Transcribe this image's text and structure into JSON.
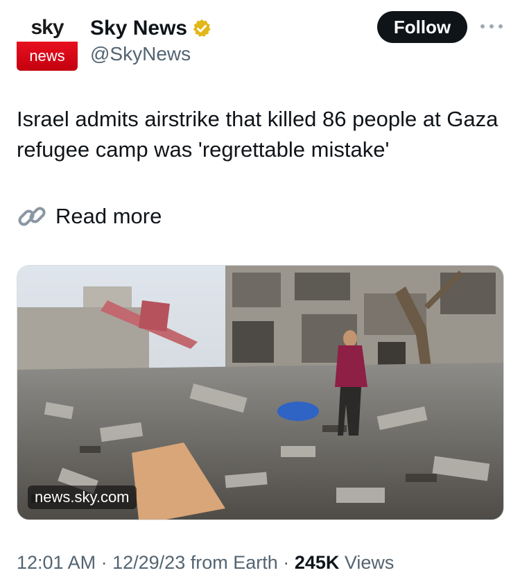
{
  "account": {
    "avatar_top": "sky",
    "avatar_bottom": "news",
    "display_name": "Sky News",
    "handle": "@SkyNews",
    "verified": true
  },
  "actions": {
    "follow_label": "Follow",
    "more_icon": "more-horizontal-icon"
  },
  "tweet": {
    "text": "Israel admits airstrike that killed 86 people at Gaza refugee camp was 'regrettable mistake'",
    "link_label": "Read more",
    "link_icon": "link-icon"
  },
  "media": {
    "source": "news.sky.com"
  },
  "meta": {
    "time": "12:01 AM",
    "separator": "·",
    "date": "12/29/23",
    "via": "from Earth",
    "views_count": "245K",
    "views_label": "Views"
  },
  "colors": {
    "accent_dark": "#0f1419",
    "secondary_text": "#536471",
    "verified_gold": "#e2b719",
    "sky_red": "#e8101f"
  }
}
